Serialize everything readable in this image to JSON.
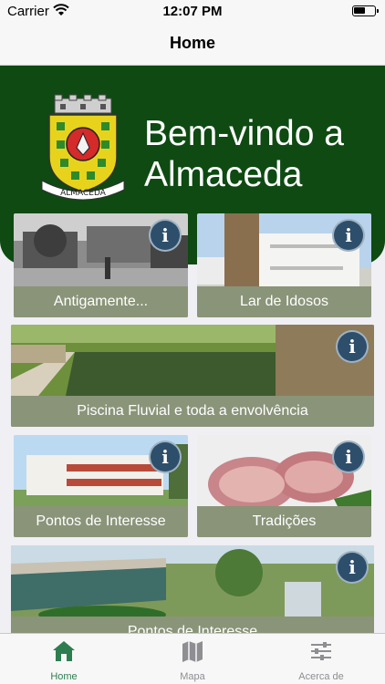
{
  "status_bar": {
    "carrier": "Carrier",
    "time": "12:07 PM",
    "battery_level": 0.6
  },
  "nav": {
    "title": "Home"
  },
  "hero": {
    "line1": "Bem-vindo a",
    "line2": "Almaceda",
    "crest_ribbon": "ALMACEDA"
  },
  "cards": [
    {
      "label": "Antigamente...",
      "info": "i"
    },
    {
      "label": "Lar de Idosos",
      "info": "i"
    },
    {
      "label": "Piscina Fluvial e toda a envolvência",
      "info": "i"
    },
    {
      "label": "Pontos de Interesse",
      "info": "i"
    },
    {
      "label": "Tradições",
      "info": "i"
    },
    {
      "label": "Pontos de Interesse",
      "info": "i"
    }
  ],
  "tabs": [
    {
      "label": "Home",
      "icon": "home-icon",
      "active": true
    },
    {
      "label": "Mapa",
      "icon": "map-icon",
      "active": false
    },
    {
      "label": "Acerca de",
      "icon": "sliders-icon",
      "active": false
    }
  ],
  "colors": {
    "hero_green": "#0e4a12",
    "caption_bg": "#8a9479",
    "accent": "#2e7d4f",
    "info_badge": "#2e4f6b"
  }
}
